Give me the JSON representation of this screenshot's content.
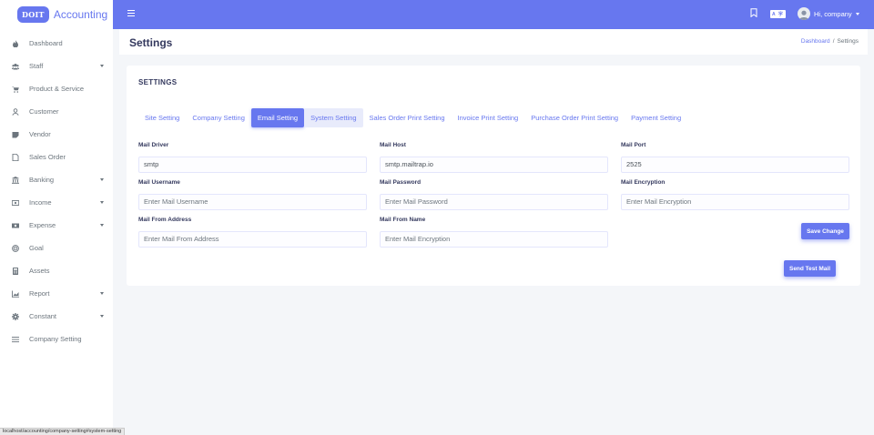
{
  "brand": {
    "logo": "DOIT",
    "name": "Accounting"
  },
  "sidebar": {
    "items": [
      {
        "label": "Dashboard",
        "icon": "fire-icon",
        "has_caret": false
      },
      {
        "label": "Staff",
        "icon": "users-icon",
        "has_caret": true
      },
      {
        "label": "Product & Service",
        "icon": "cart-icon",
        "has_caret": false
      },
      {
        "label": "Customer",
        "icon": "user-icon",
        "has_caret": false
      },
      {
        "label": "Vendor",
        "icon": "note-icon",
        "has_caret": false
      },
      {
        "label": "Sales Order",
        "icon": "file-icon",
        "has_caret": false
      },
      {
        "label": "Banking",
        "icon": "bank-icon",
        "has_caret": true
      },
      {
        "label": "Income",
        "icon": "money-icon",
        "has_caret": true
      },
      {
        "label": "Expense",
        "icon": "money-bill-icon",
        "has_caret": true
      },
      {
        "label": "Goal",
        "icon": "bullseye-icon",
        "has_caret": false
      },
      {
        "label": "Assets",
        "icon": "calculator-icon",
        "has_caret": false
      },
      {
        "label": "Report",
        "icon": "chart-icon",
        "has_caret": true
      },
      {
        "label": "Constant",
        "icon": "gear-icon",
        "has_caret": true
      },
      {
        "label": "Company Setting",
        "icon": "sliders-icon",
        "has_caret": false
      }
    ]
  },
  "topbar": {
    "lang_badge": "A 字",
    "user_label": "Hi, company"
  },
  "header": {
    "title": "Settings",
    "breadcrumb": {
      "home": "Dashboard",
      "separator": "/",
      "current": "Settings"
    }
  },
  "card": {
    "title": "SETTINGS",
    "tabs": [
      {
        "label": "Site Setting",
        "state": "normal"
      },
      {
        "label": "Company Setting",
        "state": "normal"
      },
      {
        "label": "Email Setting",
        "state": "active"
      },
      {
        "label": "System Setting",
        "state": "hover"
      },
      {
        "label": "Sales Order Print Setting",
        "state": "normal"
      },
      {
        "label": "Invoice Print Setting",
        "state": "normal"
      },
      {
        "label": "Purchase Order Print Setting",
        "state": "normal"
      },
      {
        "label": "Payment Setting",
        "state": "normal"
      }
    ],
    "fields": {
      "mail_driver": {
        "label": "Mail Driver",
        "value": "smtp",
        "placeholder": ""
      },
      "mail_host": {
        "label": "Mail Host",
        "value": "smtp.mailtrap.io",
        "placeholder": ""
      },
      "mail_port": {
        "label": "Mail Port",
        "value": "2525",
        "placeholder": ""
      },
      "mail_username": {
        "label": "Mail Username",
        "value": "",
        "placeholder": "Enter Mail Username"
      },
      "mail_password": {
        "label": "Mail Password",
        "value": "",
        "placeholder": "Enter Mail Password"
      },
      "mail_encryption": {
        "label": "Mail Encryption",
        "value": "",
        "placeholder": "Enter Mail Encryption"
      },
      "mail_from_address": {
        "label": "Mail From Address",
        "value": "",
        "placeholder": "Enter Mail From Address"
      },
      "mail_from_name": {
        "label": "Mail From Name",
        "value": "",
        "placeholder": "Enter Mail Encryption"
      }
    },
    "save_button": "Save Change",
    "test_mail_button": "Send Test Mail"
  },
  "status_bar": "localhost/accounting/company-setting#system-setting",
  "colors": {
    "primary": "#6777ef",
    "background": "#f4f6f9",
    "text": "#34395e"
  }
}
